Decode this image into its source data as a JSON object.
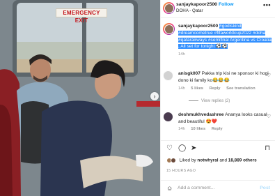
{
  "header": {
    "username": "sanjaykapoor2500",
    "separator": "•",
    "follow_label": "Follow",
    "location": "DOHA - Qatar",
    "more_label": "•••"
  },
  "photo": {
    "sign_text": "EMERGENCY EXIT",
    "next_label": "›"
  },
  "caption": {
    "username": "sanjaykapoor2500",
    "text": "#godiskind #dreamcometrue #fifaworldcup2022 #doha #qatarairways #semifinal Argentina vs Croatia , All set for tonight ⚽️⚽️",
    "time": "14h"
  },
  "comments": [
    {
      "username": "anisgk007",
      "text": "Pakka trip kisi ne sponsor ki hogi dono ki family ko😂😂😂",
      "time": "14h",
      "likes": "5 likes",
      "reply": "Reply",
      "translate": "See translation"
    },
    {
      "username": "deshmukhvedashree",
      "text": "Ananya looks casual and beautiful 😍❤️",
      "time": "14h",
      "likes": "10 likes",
      "reply": "Reply"
    }
  ],
  "view_replies": "View replies (2)",
  "actions": {
    "like_icon": "♡",
    "comment_icon": "◯",
    "share_icon": "➤",
    "save_icon": "⊓"
  },
  "likes": {
    "prefix": "Liked by",
    "user": "notwhyral",
    "mid": "and",
    "others": "18,889 others"
  },
  "posted": "15 HOURS AGO",
  "add_comment": {
    "emoji_icon": "☺",
    "placeholder": "Add a comment...",
    "post_label": "Post"
  },
  "colors": {
    "accent": "#0095f6",
    "highlight": "#3390ff",
    "muted": "#8e8e8e"
  }
}
